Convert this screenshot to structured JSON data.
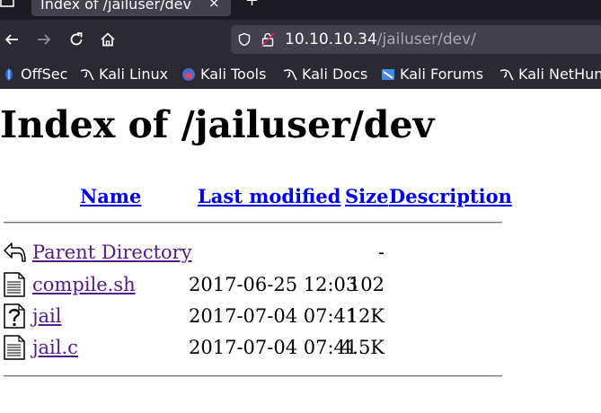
{
  "browser": {
    "tab_title": "Index of /jailuser/dev",
    "tab_close": "×",
    "new_tab": "+",
    "url_host": "10.10.10.34",
    "url_path": "/jailuser/dev/",
    "bookmarks": [
      {
        "label": "OffSec",
        "icon": "offsec-icon"
      },
      {
        "label": "Kali Linux",
        "icon": "kali-dragon-icon"
      },
      {
        "label": "Kali Tools",
        "icon": "kali-tools-icon"
      },
      {
        "label": "Kali Docs",
        "icon": "kali-dragon-icon"
      },
      {
        "label": "Kali Forums",
        "icon": "kali-forums-icon"
      },
      {
        "label": "Kali NetHunter",
        "icon": "kali-dragon-icon"
      }
    ],
    "colors": {
      "chrome_dark": "#1c1b22",
      "chrome": "#2b2a33",
      "field": "#42414d"
    }
  },
  "page": {
    "title": "Index of /jailuser/dev",
    "columns": {
      "name": "Name",
      "last_modified": "Last modified",
      "size": "Size",
      "description": "Description"
    },
    "rows": [
      {
        "icon": "back-arrow-icon",
        "name": "Parent Directory",
        "date": "",
        "size": "-"
      },
      {
        "icon": "text-file-icon",
        "name": "compile.sh",
        "date": "2017-06-25 12:03",
        "size": "102"
      },
      {
        "icon": "unknown-file-icon",
        "name": "jail",
        "date": "2017-07-04 07:41",
        "size": "12K"
      },
      {
        "icon": "text-file-icon",
        "name": "jail.c",
        "date": "2017-07-04 07:41",
        "size": "4.5K"
      }
    ],
    "colors": {
      "link": "#0000ee",
      "visited": "#551a8b"
    }
  }
}
